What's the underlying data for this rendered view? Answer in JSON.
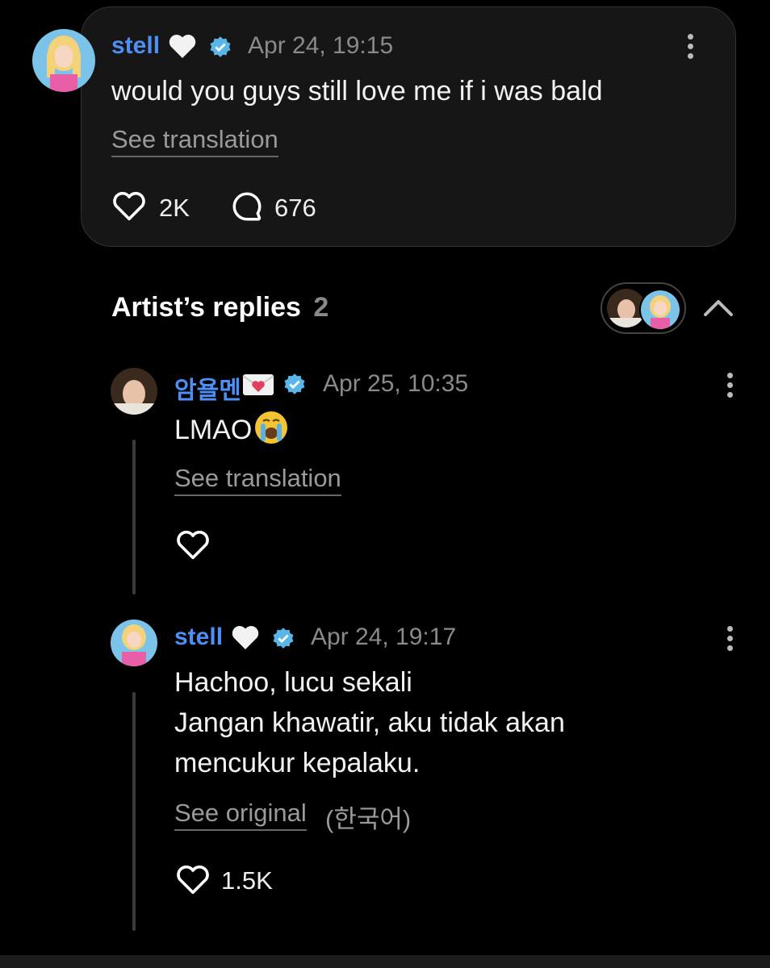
{
  "post": {
    "author": "stell",
    "timestamp": "Apr 24, 19:15",
    "text": "would you guys still love me if i was bald",
    "translation_link": "See translation",
    "likes": "2K",
    "comments": "676"
  },
  "replies_section": {
    "title": "Artist’s replies",
    "count": "2"
  },
  "replies": [
    {
      "author": "암욜멘",
      "timestamp": "Apr 25, 10:35",
      "text": "LMAO",
      "translation_link": "See translation",
      "likes": ""
    },
    {
      "author": "stell",
      "timestamp": "Apr 24, 19:17",
      "lines": [
        "Hachoo, lucu sekali",
        "Jangan khawatir, aku tidak akan",
        "mencukur kepalaku."
      ],
      "original_link": "See original",
      "original_lang": "(한국어)",
      "likes": "1.5K"
    }
  ],
  "colors": {
    "accent_name": "#4d8ff5",
    "verified": "#5ab6e8",
    "background": "#000000",
    "card": "#161616"
  }
}
